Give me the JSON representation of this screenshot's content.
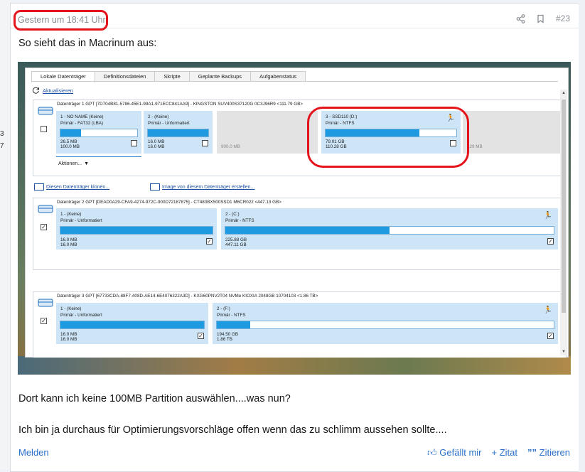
{
  "post": {
    "timestamp": "Gestern um 18:41 Uhr",
    "post_number": "#23",
    "intro": "So sieht das in Macrinum aus:",
    "line1": "Dort kann ich keine 100MB Partition auswählen....was nun?",
    "line2": "Ich bin ja durchaus für Optimierungsvorschläge offen wenn das zu schlimm aussehen sollte...."
  },
  "left_margin": {
    "a": "3",
    "b": "7"
  },
  "footer": {
    "report": "Melden",
    "like": "Gefällt mir",
    "quote": "+ Zitat",
    "multiquote": "Zitieren"
  },
  "icons": {
    "share": "share-icon",
    "bookmark": "bookmark-icon",
    "like": "thumbs-up-icon",
    "quote": "quote-icon"
  },
  "colors": {
    "highlight": "#e5141c",
    "link": "#2a6fc9",
    "partition_bg": "#cde5f7",
    "bar_fill": "#1e9be0"
  },
  "app": {
    "tabs": [
      "Lokale Datenträger",
      "Definitionsdateien",
      "Skripte",
      "Geplante Backups",
      "Aufgabenstatus"
    ],
    "refresh": "Aktualisieren",
    "clone_link": "Diesen Datenträger klonen...",
    "image_link": "Image von diesem Datenträger erstellen...",
    "actions": "Aktionen...",
    "disk1": {
      "title": "Datenträger 1 GPT [7D704B81-5786-45E1-99A1-971ECC841AA9] - KINGSTON SUV400S37120G 0C3J96R9  <111.79 GB>",
      "p1": {
        "name": "1 - NO NAME (Keine)",
        "type": "Primär - FAT32 (LBA)",
        "used": "26.5 MB",
        "size": "100.0 MB",
        "fill": 0.27
      },
      "p2": {
        "name": "2 - (Keine)",
        "type": "Primär - Unformatiert",
        "used": "16.0 MB",
        "size": "16.0 MB",
        "fill": 1.0
      },
      "free": "900.0 MB",
      "p3": {
        "name": "3 - SSD110 (D:)",
        "type": "Primär - NTFS",
        "used": "79.01 GB",
        "size": "110.28 GB",
        "fill": 0.72
      },
      "tail": "529 MB"
    },
    "disk2": {
      "title": "Datenträger 2 GPT [DEAD0A29-CFA9-4274-972C-900D72187875] - CT480BX500SSD1  M6CR022  <447.13 GB>",
      "p1": {
        "name": "1 - (Keine)",
        "type": "Primär - Unformatiert",
        "used": "16.0 MB",
        "size": "16.0 MB",
        "fill": 1.0
      },
      "p2": {
        "name": "2 - (C:)",
        "type": "Primär - NTFS",
        "used": "225.88 GB",
        "size": "447.11 GB",
        "fill": 0.5
      }
    },
    "disk3": {
      "title": "Datenträger 3 GPT [67733CDA-88F7-408D-AE14-6E4076322A3D] - KXG60PNV2T04 NVMe KIOXIA 2048GB 10704103  <1.86 TB>",
      "p1": {
        "name": "1 - (Keine)",
        "type": "Primär - Unformatiert",
        "used": "16.0 MB",
        "size": "16.0 MB",
        "fill": 1.0
      },
      "p2": {
        "name": "2 - (F:)",
        "type": "Primär - NTFS",
        "used": "194.50 GB",
        "size": "1.86 TB",
        "fill": 0.1
      }
    }
  }
}
